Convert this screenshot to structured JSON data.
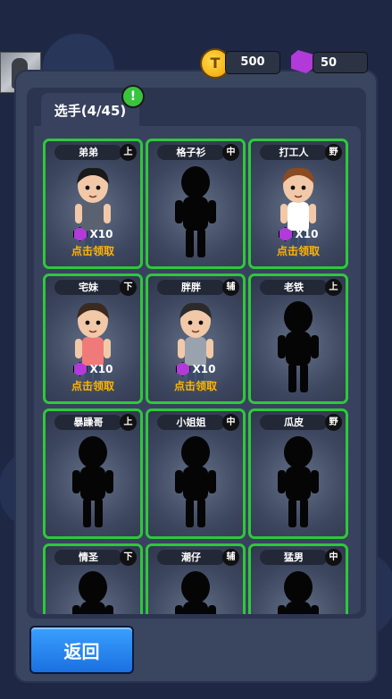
{
  "currency": {
    "coins": "500",
    "gems": "50"
  },
  "tab": {
    "label": "选手(4/45)",
    "alert": "!"
  },
  "cards": [
    {
      "name": "弟弟",
      "pos": "上",
      "unlocked": true,
      "reward": "X10",
      "claim": "点击领取"
    },
    {
      "name": "格子衫",
      "pos": "中",
      "unlocked": false
    },
    {
      "name": "打工人",
      "pos": "野",
      "unlocked": true,
      "reward": "X10",
      "claim": "点击领取"
    },
    {
      "name": "宅妹",
      "pos": "下",
      "unlocked": true,
      "reward": "X10",
      "claim": "点击领取"
    },
    {
      "name": "胖胖",
      "pos": "辅",
      "unlocked": true,
      "reward": "X10",
      "claim": "点击领取"
    },
    {
      "name": "老铁",
      "pos": "上",
      "unlocked": false
    },
    {
      "name": "暴躁哥",
      "pos": "上",
      "unlocked": false
    },
    {
      "name": "小姐姐",
      "pos": "中",
      "unlocked": false
    },
    {
      "name": "瓜皮",
      "pos": "野",
      "unlocked": false
    },
    {
      "name": "情圣",
      "pos": "下",
      "unlocked": false
    },
    {
      "name": "潮仔",
      "pos": "辅",
      "unlocked": false
    },
    {
      "name": "猛男",
      "pos": "中",
      "unlocked": false
    }
  ],
  "back_label": "返回"
}
